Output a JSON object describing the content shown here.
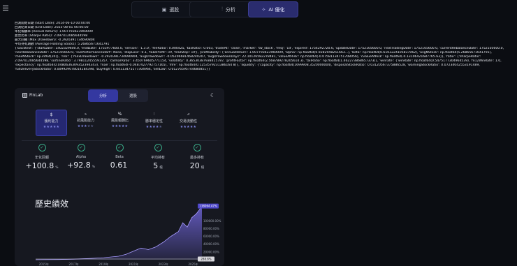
{
  "nav": {
    "tabs": [
      {
        "label": "選股",
        "icon": "▣"
      },
      {
        "label": "分析",
        "icon": "⫶"
      },
      {
        "label": "AI 優化",
        "icon": "✧"
      }
    ]
  },
  "log_lines": [
    "回測開始日期 (Start Date): 2014-06-10 00:00:00",
    "回測結束日期 (End Date): 2025-08-01 00:00:00",
    "年化報酬率 (Annual Return): 1.007793623969009",
    "夏普比率 (Sharpe Ratio): 2.097412085644598",
    "最大回撤 (Max Drawdown): -0.2920391734690804",
    "平均持有期數 (Average Holding Stocks): 5.26865671641791",
    "{'backtest': {'startDate': 1402329600.0, 'endDate': 1753977600.0, 'version': '1.3.0', 'feeRatio': 0.000425, 'taxRatio': 0.003, 'tradeAt': 'close', 'market': 'tw_stock', 'freq': '1d', 'expired': 1754292720.0, 'updateDate': 1752105600.0, 'nextTradingDate': 1752105600.0, 'currentRebalanceDate': 1752105600.0,",
    "'nextRebalanceDate': 1752105600.0, 'livePerformanceStart': None, 'stopLoss': 0.1, 'takeProfit': inf, 'trailStop': inf}, 'profitability': {'annualReturn': 1.007793623969009, 'alpha': np.float64(0.9282948251663...), 'beta': np.float64(0.6103224105837062), 'avgNStock': np.float64(5.26865671641791),",
    "'maxNStock': np.int64(20)}, 'risk': {'maxDrawdown': -0.2920391734690904, 'avgDrawdown': -0.05206681468240207, 'avgDrawdownDays': 22.10126582278481, 'valueAtRisk': np.float64(-0.07581134751708056), 'cvalueAtRisk': np.float64(-0.13106421687765.63)}, 'ratio': {'sharpeRatio':",
    "2.097412085644598, 'sortinoRatio': 3.798112455591357, 'calmarRatio': 3.450769605771154, 'volatility': 0.36530387938415787, 'profitFactor': np.float64(2.568789278205614 3), 'tailRatio': np.float64(1.462273868657373)}, 'winrate': {'winRate': np.float64(0.5475177304964539), 'm12WinRate': 1.0,",
    "'expectancy': np.float64(0.0480636309352394343), 'mae': np.float64(-0.0487427792757165), 'mfe': np.float64(0.1253579231386164 8)}, 'liquidity': {'capacity': np.float64(1699908.3520000004), 'disposalStockRatio': 0.03120567375886528, 'warningStockRatio': 0.07234042553191489,",
    "'fullDeliveryStockRatio': 0.009929078014184398, 'buyHigh': 0.04113475177304964, 'sellLow': 0.01276595744680851}}"
  ],
  "app": {
    "logo_text": "FinLab",
    "segment": [
      {
        "label": "分析",
        "active": true
      },
      {
        "label": "選股",
        "active": false
      }
    ],
    "categories": [
      {
        "icon": "$",
        "label": "獲利能力",
        "stars": 5,
        "active": true
      },
      {
        "icon": "⌁",
        "label": "抗風險能力",
        "stars": 3,
        "active": false
      },
      {
        "icon": "%",
        "label": "風險報酬比",
        "stars": 5,
        "active": false
      },
      {
        "icon": "⫶",
        "label": "勝率穩定性",
        "stars": 4,
        "active": false
      },
      {
        "icon": "⩘",
        "label": "交易流動性",
        "stars": 5,
        "active": false
      }
    ],
    "metrics": [
      {
        "label": "年化回報",
        "value": "+100.8",
        "unit": "%"
      },
      {
        "label": "Alpha",
        "value": "+92.8",
        "unit": "%"
      },
      {
        "label": "Beta",
        "value": "0.61",
        "unit": ""
      },
      {
        "label": "平均持有",
        "value": "5",
        "unit": "檔"
      },
      {
        "label": "最多持有",
        "value": "20",
        "unit": "檔"
      }
    ],
    "history_title": "歷史績效"
  },
  "chart_data": {
    "type": "area",
    "x_ticks": [
      "2015年",
      "2017年",
      "2019年",
      "2021年",
      "2023年",
      "2025年"
    ],
    "y_ticks": [
      "100000.00%",
      "80000.00%",
      "60000.00%",
      "40000.00%",
      "20000.00%",
      "0.00%"
    ],
    "ylim": [
      0,
      140000
    ],
    "start_year": 2014.45,
    "end_year": 2025.58,
    "last_label": "138064.47%",
    "benchmark_label": "288.8%",
    "accent": "#7b6ff0",
    "series": [
      {
        "x": 2014.45,
        "y": 0
      },
      {
        "x": 2015.0,
        "y": 200
      },
      {
        "x": 2016.0,
        "y": 600
      },
      {
        "x": 2017.0,
        "y": 1400
      },
      {
        "x": 2018.0,
        "y": 3000
      },
      {
        "x": 2019.0,
        "y": 5200
      },
      {
        "x": 2020.0,
        "y": 9000
      },
      {
        "x": 2020.5,
        "y": 14000
      },
      {
        "x": 2021.0,
        "y": 22000
      },
      {
        "x": 2021.5,
        "y": 30000
      },
      {
        "x": 2022.0,
        "y": 26000
      },
      {
        "x": 2022.5,
        "y": 33000
      },
      {
        "x": 2023.0,
        "y": 45000
      },
      {
        "x": 2023.5,
        "y": 60000
      },
      {
        "x": 2024.0,
        "y": 72000
      },
      {
        "x": 2024.3,
        "y": 95000
      },
      {
        "x": 2024.6,
        "y": 84000
      },
      {
        "x": 2024.9,
        "y": 108000
      },
      {
        "x": 2025.2,
        "y": 118000
      },
      {
        "x": 2025.4,
        "y": 128000
      },
      {
        "x": 2025.58,
        "y": 138064
      }
    ]
  }
}
